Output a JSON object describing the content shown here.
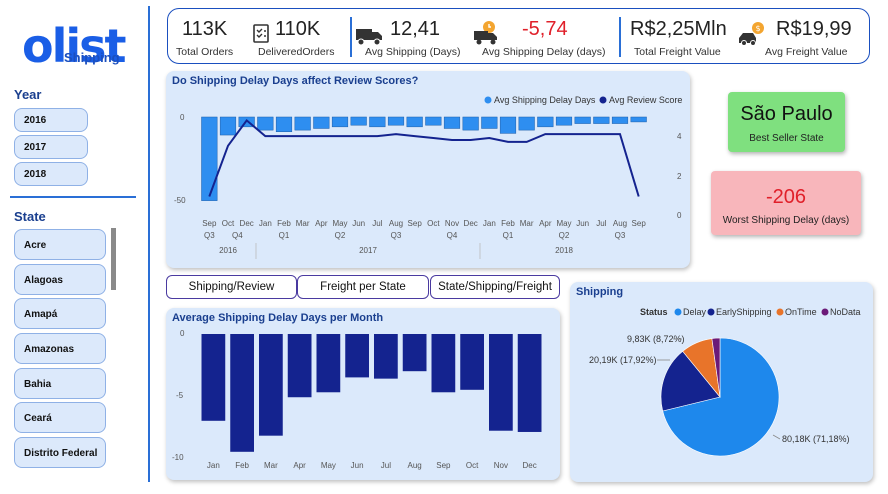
{
  "logo": {
    "word": "olist",
    "subtitle": "Shipping"
  },
  "year_slicer": {
    "title": "Year",
    "items": [
      "2016",
      "2017",
      "2018"
    ]
  },
  "state_slicer": {
    "title": "State",
    "items": [
      "Acre",
      "Alagoas",
      "Amapá",
      "Amazonas",
      "Bahia",
      "Ceará",
      "Distrito Federal"
    ]
  },
  "kpis": {
    "total_orders": {
      "value": "113K",
      "label": "Total Orders"
    },
    "delivered_orders": {
      "value": "110K",
      "label": "DeliveredOrders"
    },
    "avg_shipping": {
      "value": "12,41",
      "label": "Avg Shipping (Days)"
    },
    "avg_delay": {
      "value": "-5,74",
      "label": "Avg Shipping Delay (days)"
    },
    "total_freight": {
      "value": "R$2,25Mln",
      "label": "Total Freight Value"
    },
    "avg_freight": {
      "value": "R$19,99",
      "label": "Avg Freight Value"
    }
  },
  "colors": {
    "accent": "#1a4fbf",
    "delay_red": "#e0202a",
    "bar_blue": "#2e8ef0",
    "navy": "#14238f",
    "green_card": "#7fe07f",
    "red_card": "#f8b6bb"
  },
  "cards": {
    "best_state": {
      "value": "São Paulo",
      "label": "Best Seller State"
    },
    "worst_delay": {
      "value": "-206",
      "label": "Worst Shipping Delay (days)"
    }
  },
  "tabs": [
    "Shipping/Review",
    "Freight per State",
    "State/Shipping/Freight"
  ],
  "chart_data": [
    {
      "type": "bar",
      "title": "Do Shipping Delay Days affect Review Scores?",
      "legend": [
        "Avg Shipping Delay Days",
        "Avg Review Score"
      ],
      "legend_position": "top-right",
      "categories": [
        "Sep",
        "Oct",
        "Dec",
        "Jan",
        "Feb",
        "Mar",
        "Apr",
        "May",
        "Jun",
        "Jul",
        "Aug",
        "Sep",
        "Oct",
        "Nov",
        "Dec",
        "Jan",
        "Feb",
        "Mar",
        "Apr",
        "May",
        "Jun",
        "Jul",
        "Aug",
        "Sep"
      ],
      "quarter_labels": [
        "Q3",
        "Q4",
        "Q1",
        "Q2",
        "Q3",
        "Q4",
        "Q1",
        "Q2",
        "Q3"
      ],
      "year_labels": [
        "2016",
        "2017",
        "2018"
      ],
      "series": [
        {
          "name": "Avg Shipping Delay Days",
          "type": "bar",
          "axis": "left",
          "values": [
            -51,
            -11,
            -6,
            -8,
            -9,
            -8,
            -7,
            -6,
            -5,
            -6,
            -5,
            -6,
            -5,
            -7,
            -8,
            -7,
            -10,
            -8,
            -6,
            -5,
            -4,
            -4,
            -4,
            -3
          ]
        },
        {
          "name": "Avg Review Score",
          "type": "line",
          "axis": "right",
          "values": [
            1.0,
            3.6,
            4.9,
            4.1,
            4.1,
            4.1,
            4.1,
            4.1,
            4.1,
            4.1,
            4.2,
            4.1,
            4.0,
            3.9,
            3.9,
            4.0,
            3.8,
            3.8,
            4.2,
            4.2,
            4.2,
            4.2,
            4.2,
            1.0
          ]
        }
      ],
      "y_left_ticks": [
        "0",
        "-50"
      ],
      "y_right_ticks": [
        "4",
        "2",
        "0"
      ]
    },
    {
      "type": "bar",
      "title": "Average Shipping Delay Days per Month",
      "categories": [
        "Jan",
        "Feb",
        "Mar",
        "Apr",
        "May",
        "Jun",
        "Jul",
        "Aug",
        "Sep",
        "Oct",
        "Nov",
        "Dec"
      ],
      "values": [
        -7.0,
        -9.5,
        -8.2,
        -5.1,
        -4.7,
        -3.5,
        -3.6,
        -3.0,
        -4.7,
        -4.5,
        -7.8,
        -7.9
      ],
      "ylim": [
        -10,
        0
      ],
      "y_ticks": [
        "0",
        "-5",
        "-10"
      ]
    },
    {
      "type": "pie",
      "title": "Shipping",
      "legend_title": "Status",
      "legend": [
        "Delay",
        "EarlyShipping",
        "OnTime",
        "NoData"
      ],
      "legend_position": "top",
      "slices": [
        {
          "name": "Delay",
          "value": 71.18,
          "label": "80,18K (71,18%)",
          "color": "#1e88ec"
        },
        {
          "name": "EarlyShipping",
          "value": 17.92,
          "label": "20,19K (17,92%)",
          "color": "#14238f"
        },
        {
          "name": "OnTime",
          "value": 8.72,
          "label": "9,83K (8,72%)",
          "color": "#e8742a"
        },
        {
          "name": "NoData",
          "value": 2.18,
          "label": "",
          "color": "#6b1a78"
        }
      ]
    }
  ]
}
